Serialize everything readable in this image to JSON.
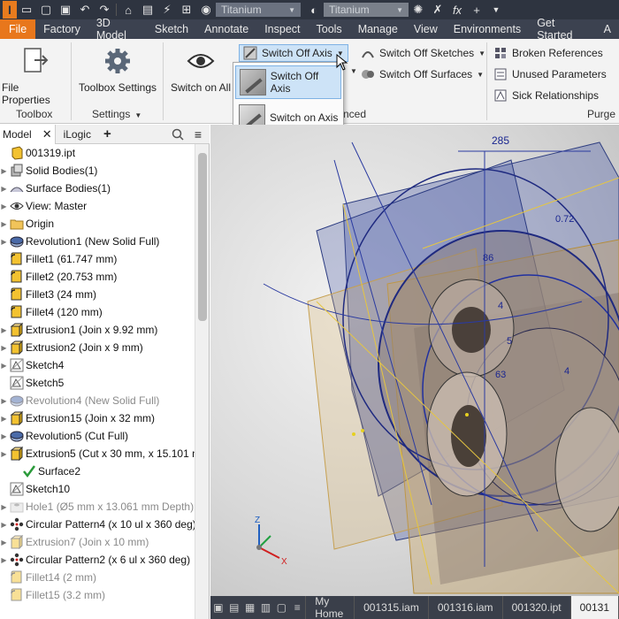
{
  "titlebar": {
    "app_letter": "I",
    "material_combo": "Titanium",
    "appearance_combo": "Titanium",
    "fx_label": "fx"
  },
  "tabs": [
    "File",
    "Factory",
    "3D Model",
    "Sketch",
    "Annotate",
    "Inspect",
    "Tools",
    "Manage",
    "View",
    "Environments",
    "Get Started",
    "A"
  ],
  "ribbon": {
    "file_properties": "File Properties",
    "toolbox_settings": "Toolbox Settings",
    "switch_on_all": "Switch on All",
    "switch_off_axis": "Switch Off Axis",
    "switch_off_sketches": "Switch Off Sketches",
    "switch_off_surfaces": "Switch Off Surfaces",
    "broken_references": "Broken References",
    "unused_parameters": "Unused Parameters",
    "sick_relationships": "Sick Relationships",
    "group_toolbox": "Toolbox",
    "group_settings": "Settings",
    "group_advanced_partial": "nced",
    "group_purge": "Purge"
  },
  "dropdown": {
    "items": [
      "Switch Off Axis",
      "Switch on Axis"
    ]
  },
  "browser": {
    "tab_model": "Model",
    "tab_ilogic": "iLogic",
    "add_tab": "+",
    "nodes": [
      {
        "label": "001319.ipt",
        "icon": "part-icon",
        "dim": false,
        "expander": ""
      },
      {
        "label": "Solid Bodies(1)",
        "icon": "solid-bodies-icon",
        "dim": false,
        "expander": "▶"
      },
      {
        "label": "Surface Bodies(1)",
        "icon": "surface-bodies-icon",
        "dim": false,
        "expander": "▶"
      },
      {
        "label": "View: Master",
        "icon": "view-icon",
        "dim": false,
        "expander": "▶"
      },
      {
        "label": "Origin",
        "icon": "folder-icon",
        "dim": false,
        "expander": "▶"
      },
      {
        "label": "Revolution1 (New Solid Full)",
        "icon": "revolve-icon",
        "dim": false,
        "expander": "▶"
      },
      {
        "label": "Fillet1 (61.747 mm)",
        "icon": "fillet-icon",
        "dim": false,
        "expander": ""
      },
      {
        "label": "Fillet2 (20.753 mm)",
        "icon": "fillet-icon",
        "dim": false,
        "expander": ""
      },
      {
        "label": "Fillet3 (24 mm)",
        "icon": "fillet-icon",
        "dim": false,
        "expander": ""
      },
      {
        "label": "Fillet4 (120 mm)",
        "icon": "fillet-icon",
        "dim": false,
        "expander": ""
      },
      {
        "label": "Extrusion1 (Join x 9.92 mm)",
        "icon": "extrude-icon",
        "dim": false,
        "expander": "▶"
      },
      {
        "label": "Extrusion2 (Join x 9 mm)",
        "icon": "extrude-icon",
        "dim": false,
        "expander": "▶"
      },
      {
        "label": "Sketch4",
        "icon": "sketch-icon",
        "dim": false,
        "expander": "▶"
      },
      {
        "label": "Sketch5",
        "icon": "sketch-icon",
        "dim": false,
        "expander": ""
      },
      {
        "label": "Revolution4 (New Solid Full)",
        "icon": "revolve-icon",
        "dim": true,
        "expander": "▶"
      },
      {
        "label": "Extrusion15 (Join x 32 mm)",
        "icon": "extrude-icon",
        "dim": false,
        "expander": "▶"
      },
      {
        "label": "Revolution5 (Cut Full)",
        "icon": "revolve-icon",
        "dim": false,
        "expander": "▶"
      },
      {
        "label": "Extrusion5 (Cut x 30 mm, x 15.101 m",
        "icon": "extrude-icon",
        "dim": false,
        "expander": "▶"
      },
      {
        "label": "Surface2",
        "icon": "check-icon",
        "dim": false,
        "expander": "",
        "indent": true
      },
      {
        "label": "Sketch10",
        "icon": "sketch-icon",
        "dim": false,
        "expander": ""
      },
      {
        "label": "Hole1 (Ø5 mm x 13.061 mm Depth)",
        "icon": "hole-icon",
        "dim": true,
        "expander": "▶"
      },
      {
        "label": "Circular Pattern4 (x 10 ul x 360 deg)",
        "icon": "pattern-icon",
        "dim": false,
        "expander": "▶"
      },
      {
        "label": "Extrusion7 (Join x 10 mm)",
        "icon": "extrude-icon",
        "dim": true,
        "expander": "▶"
      },
      {
        "label": "Circular Pattern2 (x 6 ul x 360 deg)",
        "icon": "pattern-icon",
        "dim": false,
        "expander": "▶"
      },
      {
        "label": "Fillet14 (2 mm)",
        "icon": "fillet-icon",
        "dim": true,
        "expander": ""
      },
      {
        "label": "Fillet15 (3.2 mm)",
        "icon": "fillet-icon",
        "dim": true,
        "expander": ""
      }
    ]
  },
  "viewport": {
    "dimension_label": "285",
    "labels": [
      "86",
      "0.72",
      "4",
      "5",
      "63",
      "4"
    ]
  },
  "doc_tabs": {
    "items": [
      "My Home",
      "001315.iam",
      "001316.iam",
      "001320.ipt",
      "00131"
    ]
  },
  "colors": {
    "accent": "#e8771c",
    "titlebar": "#2e3440",
    "tabbar": "#3c4250",
    "selection": "#cde3f7"
  }
}
